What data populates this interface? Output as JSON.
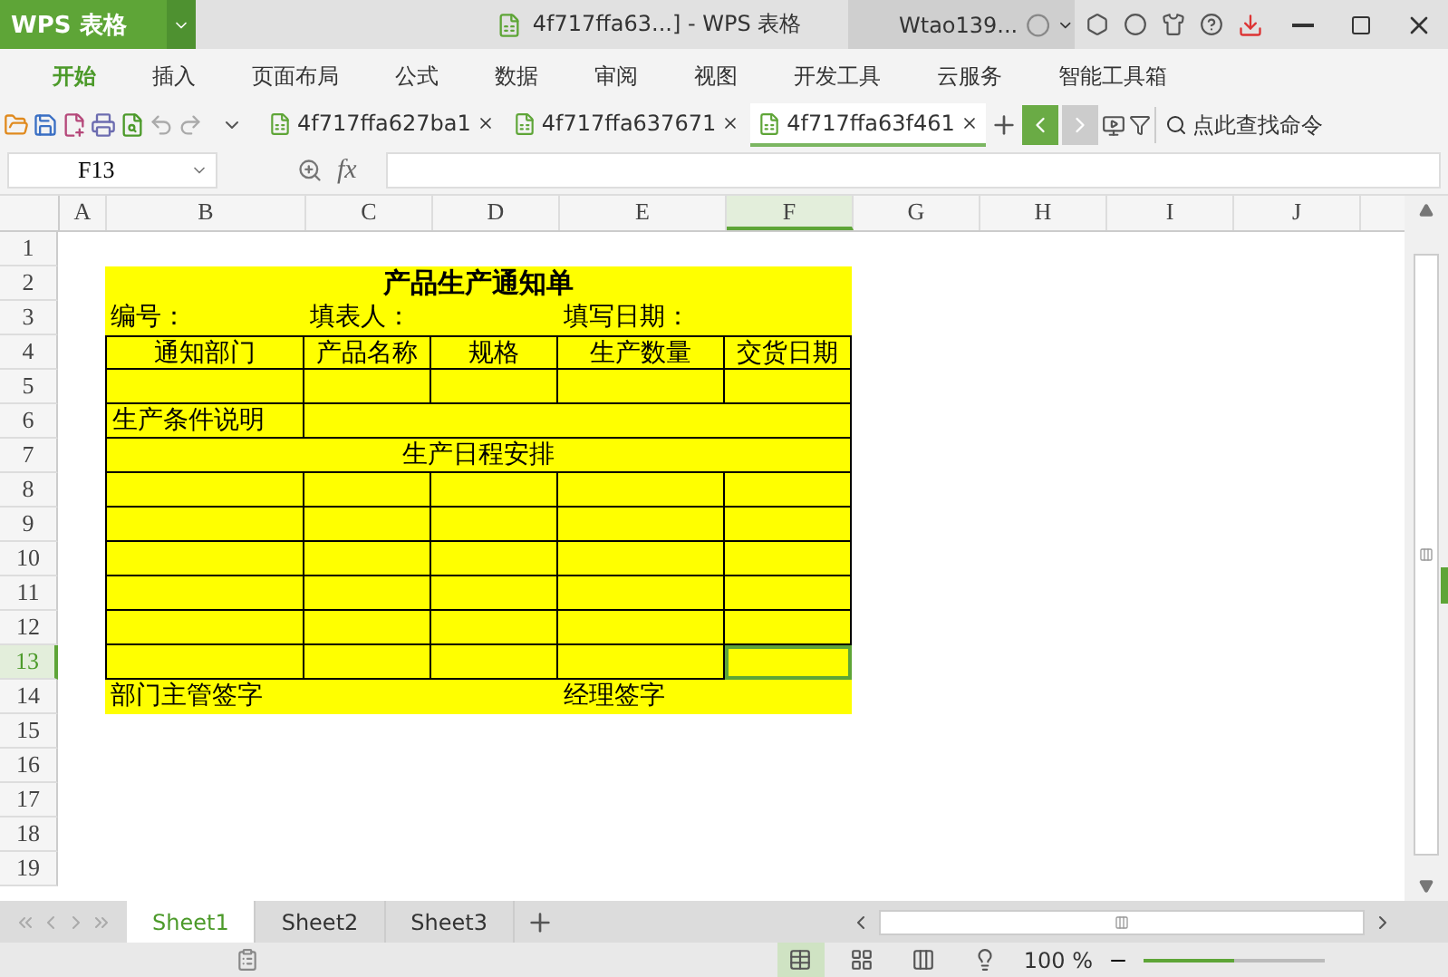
{
  "app_button": {
    "label": "WPS 表格"
  },
  "window": {
    "title": "4f717ffa63...] - WPS 表格",
    "user": "Wtao139..."
  },
  "menu": [
    {
      "label": "开始",
      "selected": true
    },
    {
      "label": "插入",
      "selected": false
    },
    {
      "label": "页面布局",
      "selected": false
    },
    {
      "label": "公式",
      "selected": false
    },
    {
      "label": "数据",
      "selected": false
    },
    {
      "label": "审阅",
      "selected": false
    },
    {
      "label": "视图",
      "selected": false
    },
    {
      "label": "开发工具",
      "selected": false
    },
    {
      "label": "云服务",
      "selected": false
    },
    {
      "label": "智能工具箱",
      "selected": false
    }
  ],
  "doc_tabs": [
    {
      "label": "4f717ffa627ba1",
      "selected": false
    },
    {
      "label": "4f717ffa637671",
      "selected": false
    },
    {
      "label": "4f717ffa63f461",
      "selected": true
    }
  ],
  "command_search": {
    "placeholder": "点此查找命令"
  },
  "formula_bar": {
    "name_box": "F13",
    "fx": "fx"
  },
  "columns": [
    {
      "label": "A",
      "selected": false
    },
    {
      "label": "B",
      "selected": false
    },
    {
      "label": "C",
      "selected": false
    },
    {
      "label": "D",
      "selected": false
    },
    {
      "label": "E",
      "selected": false
    },
    {
      "label": "F",
      "selected": true
    },
    {
      "label": "G",
      "selected": false
    },
    {
      "label": "H",
      "selected": false
    },
    {
      "label": "I",
      "selected": false
    },
    {
      "label": "J",
      "selected": false
    }
  ],
  "rows": [
    {
      "label": "1",
      "selected": false
    },
    {
      "label": "2",
      "selected": false,
      "kind": "title",
      "cells": [
        {
          "text": "产品生产通知单",
          "selected": false
        }
      ]
    },
    {
      "label": "3",
      "selected": false,
      "kind": "info",
      "cells": [
        {
          "text": "编号：",
          "selected": false
        },
        {
          "text": "填表人：",
          "selected": false
        },
        {
          "text": "填写日期：",
          "selected": false
        }
      ]
    },
    {
      "label": "4",
      "selected": false,
      "kind": "header",
      "cells": [
        {
          "text": "通知部门",
          "selected": false
        },
        {
          "text": "产品名称",
          "selected": false
        },
        {
          "text": "规格",
          "selected": false
        },
        {
          "text": "生产数量",
          "selected": false
        },
        {
          "text": "交货日期",
          "selected": false
        }
      ]
    },
    {
      "label": "5",
      "selected": false,
      "kind": "grid",
      "cells": [
        {
          "selected": false
        },
        {
          "selected": false
        },
        {
          "selected": false
        },
        {
          "selected": false
        },
        {
          "selected": false
        }
      ]
    },
    {
      "label": "6",
      "selected": false,
      "kind": "note",
      "cells": [
        {
          "text": "生产条件说明",
          "selected": false
        },
        {
          "selected": false
        }
      ]
    },
    {
      "label": "7",
      "selected": false,
      "kind": "section",
      "cells": [
        {
          "text": "生产日程安排",
          "selected": false
        }
      ]
    },
    {
      "label": "8",
      "selected": false,
      "kind": "grid",
      "cells": [
        {
          "selected": false
        },
        {
          "selected": false
        },
        {
          "selected": false
        },
        {
          "selected": false
        },
        {
          "selected": false
        }
      ]
    },
    {
      "label": "9",
      "selected": false,
      "kind": "grid",
      "cells": [
        {
          "selected": false
        },
        {
          "selected": false
        },
        {
          "selected": false
        },
        {
          "selected": false
        },
        {
          "selected": false
        }
      ]
    },
    {
      "label": "10",
      "selected": false,
      "kind": "grid",
      "cells": [
        {
          "selected": false
        },
        {
          "selected": false
        },
        {
          "selected": false
        },
        {
          "selected": false
        },
        {
          "selected": false
        }
      ]
    },
    {
      "label": "11",
      "selected": false,
      "kind": "grid",
      "cells": [
        {
          "selected": false
        },
        {
          "selected": false
        },
        {
          "selected": false
        },
        {
          "selected": false
        },
        {
          "selected": false
        }
      ]
    },
    {
      "label": "12",
      "selected": false,
      "kind": "grid",
      "cells": [
        {
          "selected": false
        },
        {
          "selected": false
        },
        {
          "selected": false
        },
        {
          "selected": false
        },
        {
          "selected": false
        }
      ]
    },
    {
      "label": "13",
      "selected": true,
      "kind": "grid",
      "cells": [
        {
          "selected": false
        },
        {
          "selected": false
        },
        {
          "selected": false
        },
        {
          "selected": false
        },
        {
          "selected": true
        }
      ]
    },
    {
      "label": "14",
      "selected": false,
      "kind": "signatures",
      "cells": [
        {
          "text": "部门主管签字",
          "selected": false
        },
        {
          "text": "经理签字",
          "selected": false
        }
      ]
    },
    {
      "label": "15",
      "selected": false
    },
    {
      "label": "16",
      "selected": false
    },
    {
      "label": "17",
      "selected": false
    },
    {
      "label": "18",
      "selected": false
    },
    {
      "label": "19",
      "selected": false
    }
  ],
  "sheets": [
    {
      "label": "Sheet1",
      "selected": true
    },
    {
      "label": "Sheet2",
      "selected": false
    },
    {
      "label": "Sheet3",
      "selected": false
    }
  ],
  "status_bar": {
    "zoom": "100 %",
    "zoom_slider": {
      "level": 0.5
    }
  }
}
